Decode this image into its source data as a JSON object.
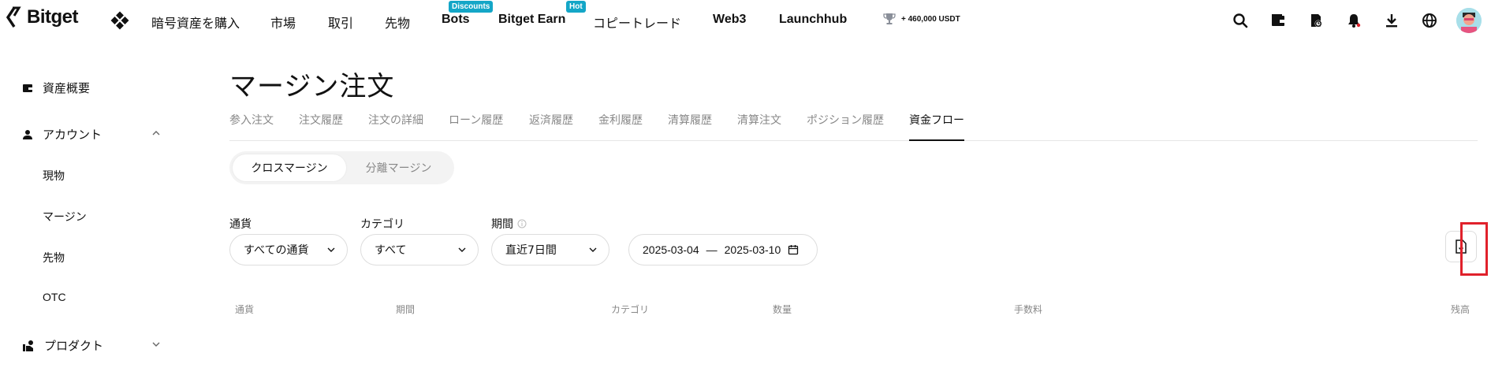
{
  "brand": {
    "name": "Bitget"
  },
  "nav": {
    "items": [
      {
        "label": "暗号資産を購入",
        "bold": false,
        "badge": ""
      },
      {
        "label": "市場",
        "bold": false,
        "badge": ""
      },
      {
        "label": "取引",
        "bold": false,
        "badge": ""
      },
      {
        "label": "先物",
        "bold": false,
        "badge": ""
      },
      {
        "label": "Bots",
        "bold": true,
        "badge": "Discounts"
      },
      {
        "label": "Bitget Earn",
        "bold": true,
        "badge": "Hot"
      },
      {
        "label": "コピートレード",
        "bold": false,
        "badge": ""
      },
      {
        "label": "Web3",
        "bold": true,
        "badge": ""
      },
      {
        "label": "Launchhub",
        "bold": true,
        "badge": ""
      }
    ],
    "promo": "+ 460,000 USDT",
    "icons": [
      "search-icon",
      "wallet-icon",
      "orders-icon",
      "bell-icon",
      "download-icon",
      "globe-icon"
    ]
  },
  "sidebar": {
    "overview": "資産概要",
    "account": "アカウント",
    "account_items": [
      "現物",
      "マージン",
      "先物",
      "OTC"
    ],
    "products": "プロダクト"
  },
  "main": {
    "title": "マージン注文",
    "tabs": [
      "参入注文",
      "注文履歴",
      "注文の詳細",
      "ローン履歴",
      "返済履歴",
      "金利履歴",
      "清算履歴",
      "清算注文",
      "ポジション履歴",
      "資金フロー"
    ],
    "active_tab": "資金フロー",
    "segment": {
      "active": "クロスマージン",
      "inactive": "分離マージン"
    },
    "filters": {
      "currency_label": "通貨",
      "currency_value": "すべての通貨",
      "category_label": "カテゴリ",
      "category_value": "すべて",
      "period_label": "期間",
      "period_value": "直近7日間",
      "date_from": "2025-03-04",
      "date_sep": "—",
      "date_to": "2025-03-10"
    },
    "table_headers": [
      "通貨",
      "期間",
      "カテゴリ",
      "数量",
      "手数料",
      "残高"
    ]
  },
  "colors": {
    "badge": "#14a6c7",
    "highlight": "#e0212b"
  }
}
